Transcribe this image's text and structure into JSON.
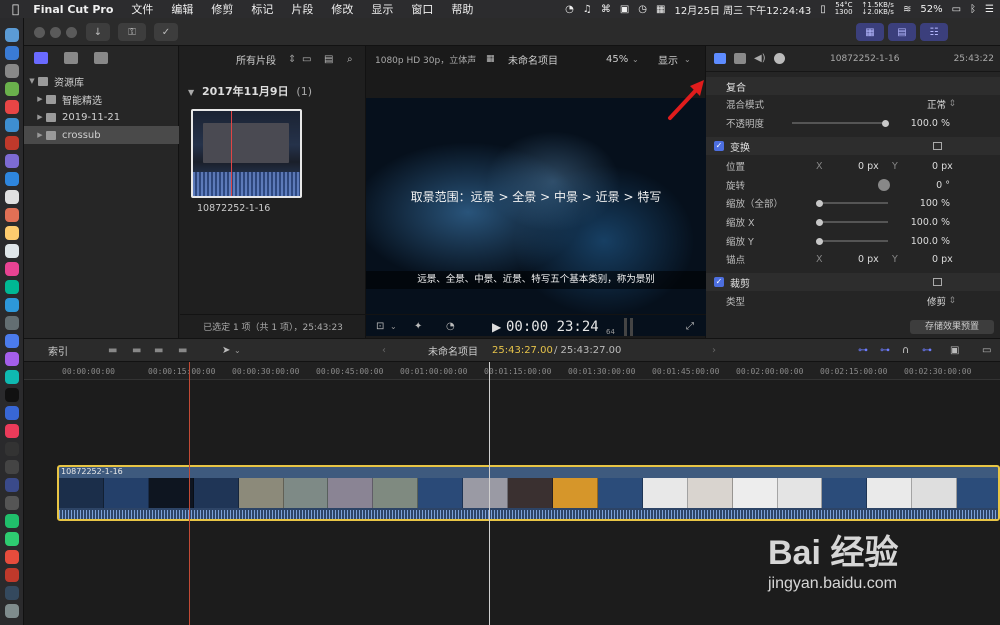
{
  "menubar": {
    "app_name": "Final Cut Pro",
    "menus": [
      "文件",
      "编辑",
      "修剪",
      "标记",
      "片段",
      "修改",
      "显示",
      "窗口",
      "帮助"
    ],
    "cpu_temp": "54°C",
    "cpu_temp2": "1300",
    "net_up": "↑1.5KB/s",
    "net_down": "↓2.0KB/s",
    "date": "12月25日 周三 下午12:24:43",
    "battery": "52%"
  },
  "library": {
    "title": "资源库",
    "items": [
      {
        "label": "智能精选"
      },
      {
        "label": "2019-11-21"
      },
      {
        "label": "crossub"
      }
    ]
  },
  "browser": {
    "filter": "所有片段",
    "date_header": "2017年11月9日",
    "date_count": "(1)",
    "clip_name": "10872252-1-16",
    "status": "已选定 1 项（共 1 项），25:43:23"
  },
  "viewer": {
    "format": "1080p HD 30p，立体声",
    "project": "未命名项目",
    "zoom": "45%",
    "display_menu": "显示",
    "title_text": "取景范围：远景 > 全景 > 中景 > 近景 > 特写",
    "caption": "远景、全景、中景、近景、特写五个基本类别，称为景别",
    "timecode": "00:00 23:24",
    "timecode_frames": "64"
  },
  "inspector": {
    "clip_name": "10872252-1-16",
    "duration": "25:43:22",
    "sections": {
      "composite": "复合",
      "blend_mode_label": "混合模式",
      "blend_mode_value": "正常",
      "opacity_label": "不透明度",
      "opacity_value": "100.0 %",
      "transform": "变换",
      "position_label": "位置",
      "pos_x_axis": "X",
      "pos_x_value": "0 px",
      "pos_y_axis": "Y",
      "pos_y_value": "0 px",
      "rotation_label": "旋转",
      "rotation_value": "0 °",
      "scale_all_label": "缩放（全部）",
      "scale_all_value": "100 %",
      "scale_x_label": "缩放 X",
      "scale_x_value": "100.0 %",
      "scale_y_label": "缩放 Y",
      "scale_y_value": "100.0 %",
      "anchor_label": "锚点",
      "anchor_x_axis": "X",
      "anchor_x_value": "0 px",
      "anchor_y_axis": "Y",
      "anchor_y_value": "0 px",
      "crop": "裁剪",
      "type_label": "类型",
      "type_value": "修剪"
    },
    "save_preset": "存储效果预置"
  },
  "timeline": {
    "index_label": "索引",
    "project": "未命名项目",
    "current": "25:43:27.00",
    "total": "/ 25:43:27.00",
    "ticks": [
      "00:00:00:00",
      "00:00:15:00:00",
      "00:00:30:00:00",
      "00:00:45:00:00",
      "00:01:00:00:00",
      "00:01:15:00:00",
      "00:01:30:00:00",
      "00:01:45:00:00",
      "00:02:00:00:00",
      "00:02:15:00:00",
      "00:02:30:00:00"
    ],
    "clip_name": "10872252-1-16"
  },
  "watermark": {
    "brand": "Bai 经验",
    "url": "jingyan.baidu.com"
  }
}
